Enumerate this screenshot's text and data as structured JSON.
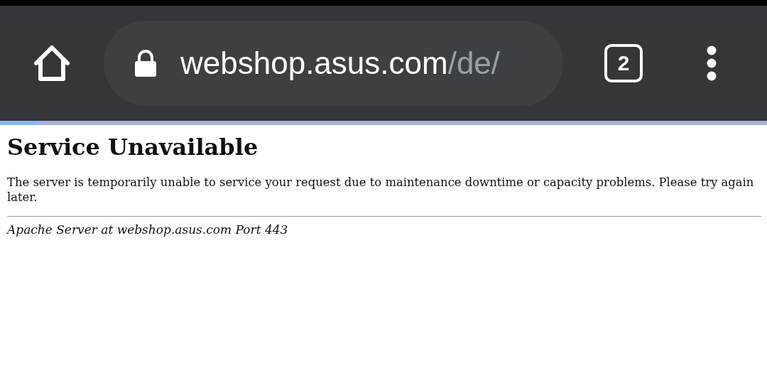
{
  "toolbar": {
    "url_host": "webshop.asus.com",
    "url_path": "/de/",
    "tab_count": "2"
  },
  "progress": {
    "level": 0.051
  },
  "page": {
    "heading": "Service Unavailable",
    "message": "The server is temporarily unable to service your request due to maintenance downtime or capacity problems. Please try again later.",
    "address": "Apache Server at webshop.asus.com Port 443"
  }
}
